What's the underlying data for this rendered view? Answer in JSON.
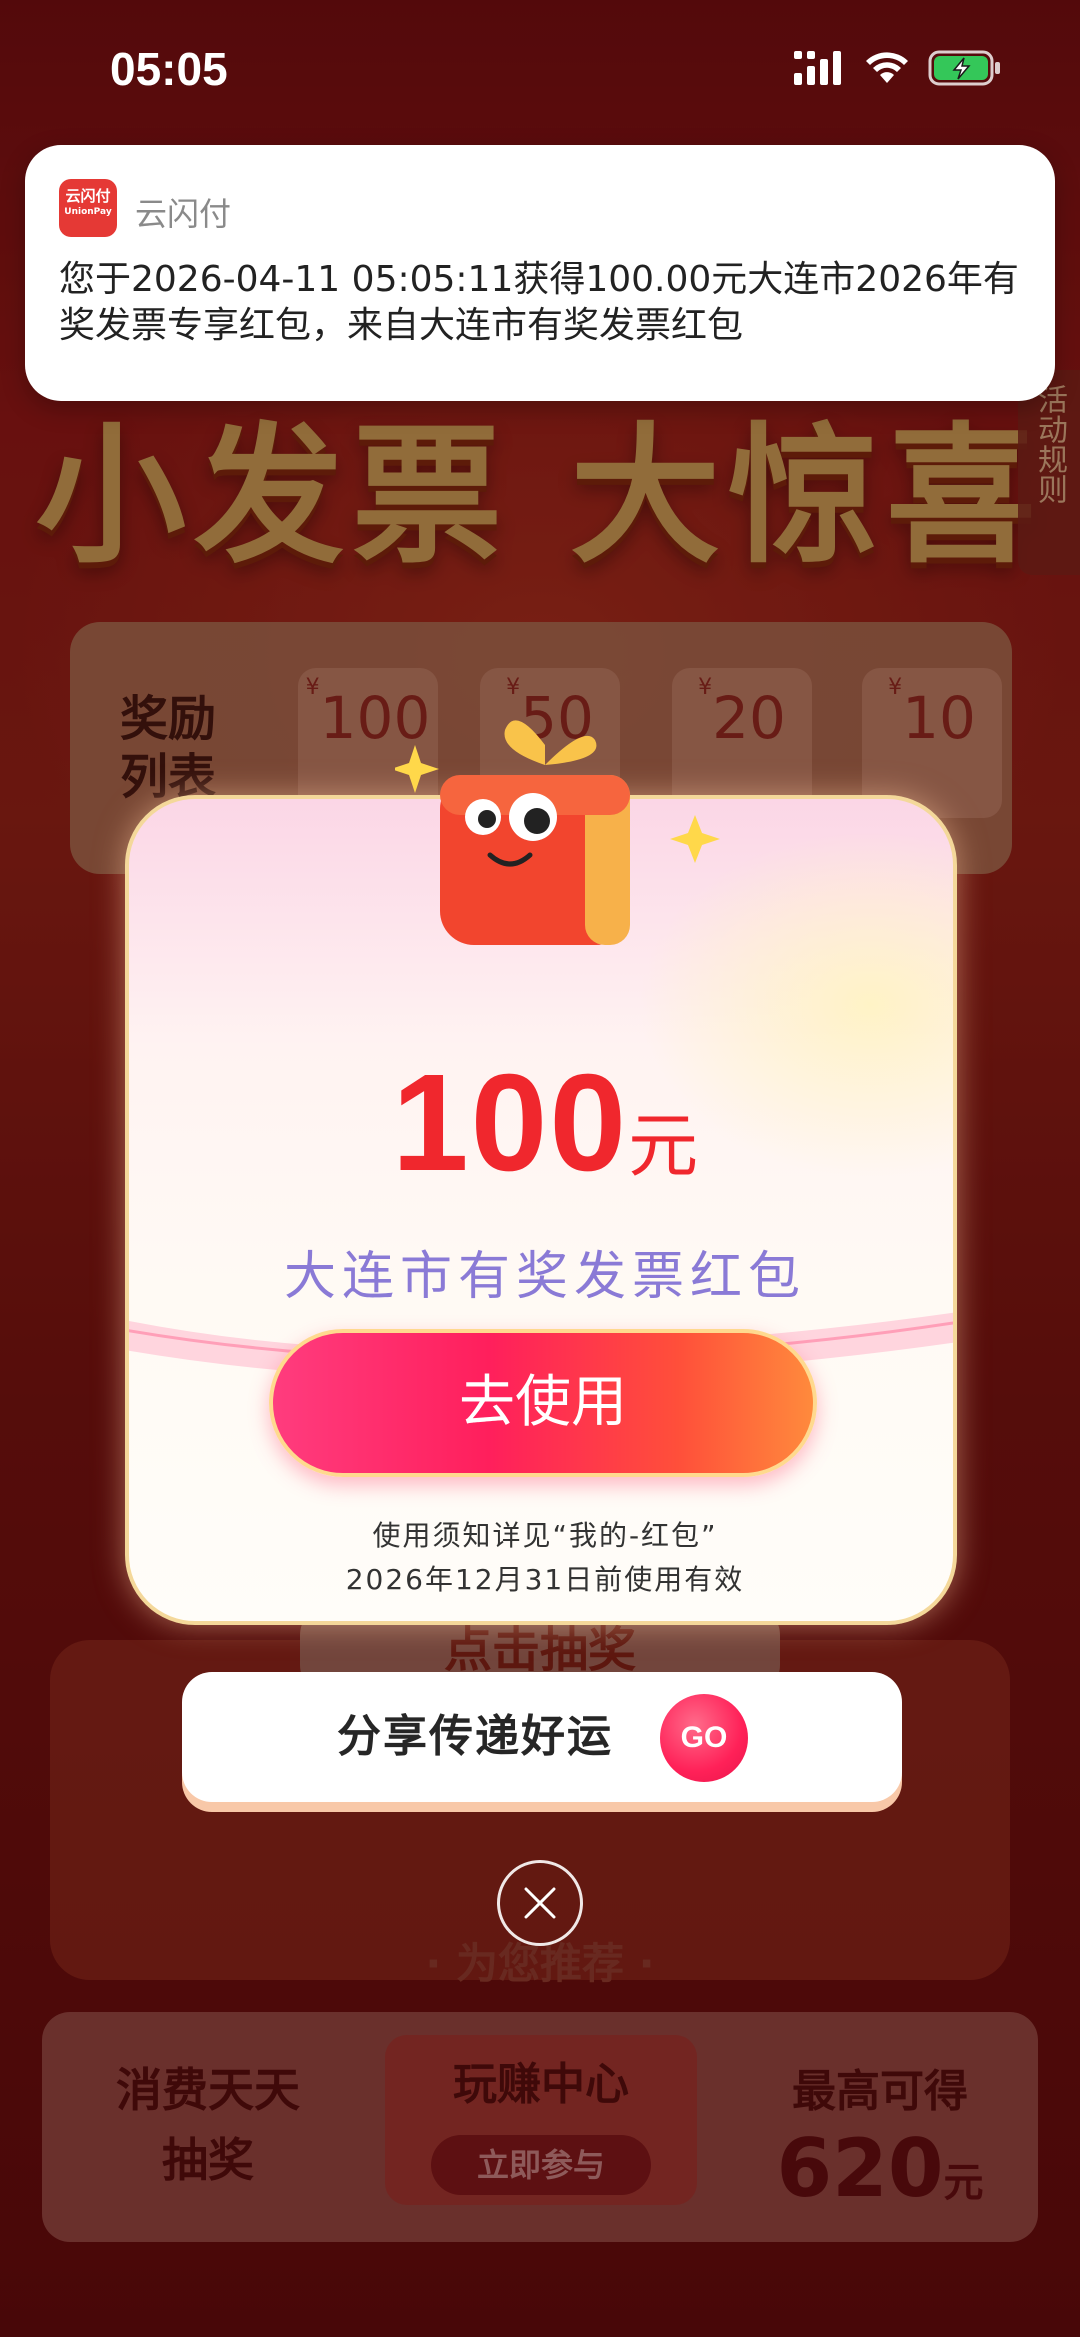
{
  "status_bar": {
    "time": "05:05"
  },
  "notification": {
    "app_name": "云闪付",
    "logo_text": "云闪付",
    "logo_sub": "UnionPay",
    "message": "您于2026-04-11 05:05:11获得100.00元大连市2026年有奖发票专享红包，来自大连市有奖发票红包"
  },
  "background": {
    "hero_title": "小发票 大惊喜",
    "rules_tab": "活动规则",
    "reward_list_label": "奖励列表",
    "reward_chips": [
      {
        "amount": "100",
        "currency": "¥"
      },
      {
        "amount": "50",
        "currency": "¥"
      },
      {
        "amount": "20",
        "currency": "¥"
      },
      {
        "amount": "10",
        "currency": "¥"
      }
    ],
    "draw_button": "点击抽奖",
    "recommend_title": "· 为您推荐 ·",
    "card_left": {
      "line1": "消费天天",
      "line2": "抽奖"
    },
    "card_mid": {
      "title": "玩赚中心",
      "button": "立即参与"
    },
    "card_right": {
      "line1": "最高可得",
      "amount": "620",
      "unit": "元"
    }
  },
  "modal": {
    "amount": "100",
    "unit": "元",
    "coupon_name": "大连市有奖发票红包",
    "use_button": "去使用",
    "notice_line1": "使用须知详见“我的-红包”",
    "notice_line2": "2026年12月31日前使用有效"
  },
  "share": {
    "label": "分享传递好运",
    "go": "GO"
  },
  "colors": {
    "accent_red": "#f0272d",
    "button_pink": "#ff1f5c",
    "name_purple": "#8a7ad6"
  }
}
